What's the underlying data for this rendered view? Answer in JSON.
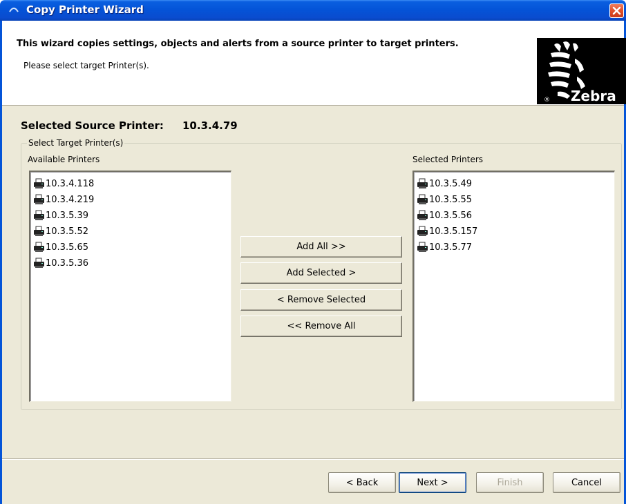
{
  "window": {
    "title": "Copy Printer Wizard"
  },
  "header": {
    "title": "This wizard copies settings, objects and alerts from a source printer to target printers.",
    "subtitle": "Please select target Printer(s).",
    "logo_text": "Zebra",
    "logo_reg": "®"
  },
  "source": {
    "label": "Selected Source Printer:",
    "value": "10.3.4.79"
  },
  "group": {
    "legend": "Select Target Printer(s)",
    "available_label": "Available Printers",
    "selected_label": "Selected Printers"
  },
  "available_printers": [
    "10.3.4.118",
    "10.3.4.219",
    "10.3.5.39",
    "10.3.5.52",
    "10.3.5.65",
    "10.3.5.36"
  ],
  "selected_printers": [
    "10.3.5.49",
    "10.3.5.55",
    "10.3.5.56",
    "10.3.5.157",
    "10.3.5.77"
  ],
  "transfer_buttons": {
    "add_all": "Add All >>",
    "add_selected": "Add Selected >",
    "remove_selected": "< Remove Selected",
    "remove_all": "<< Remove All"
  },
  "nav_buttons": {
    "back": "< Back",
    "next": "Next >",
    "finish": "Finish",
    "cancel": "Cancel"
  },
  "colors": {
    "titlebar": "#0454d8",
    "dialog_bg": "#ece9d8",
    "close_button": "#e0502a"
  }
}
